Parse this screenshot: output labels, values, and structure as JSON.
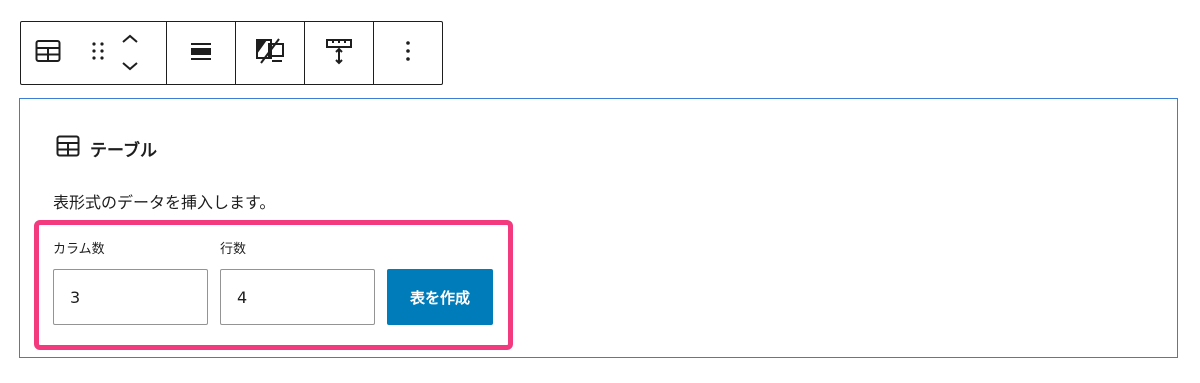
{
  "toolbar": {
    "icons": [
      "table-icon",
      "drag-handle-icon",
      "move-up-icon",
      "move-down-icon",
      "align-icon",
      "dark-mode-toggle-icon",
      "fixed-width-table-icon",
      "more-options-icon"
    ]
  },
  "block": {
    "title": "テーブル",
    "instructions": "表形式のデータを挿入します。",
    "columns_label": "カラム数",
    "columns_value": "3",
    "rows_label": "行数",
    "rows_value": "4",
    "create_label": "表を作成"
  },
  "colors": {
    "accent": "#007cba",
    "selection_border": "#3b7ed3",
    "highlight": "#f43a7e"
  }
}
